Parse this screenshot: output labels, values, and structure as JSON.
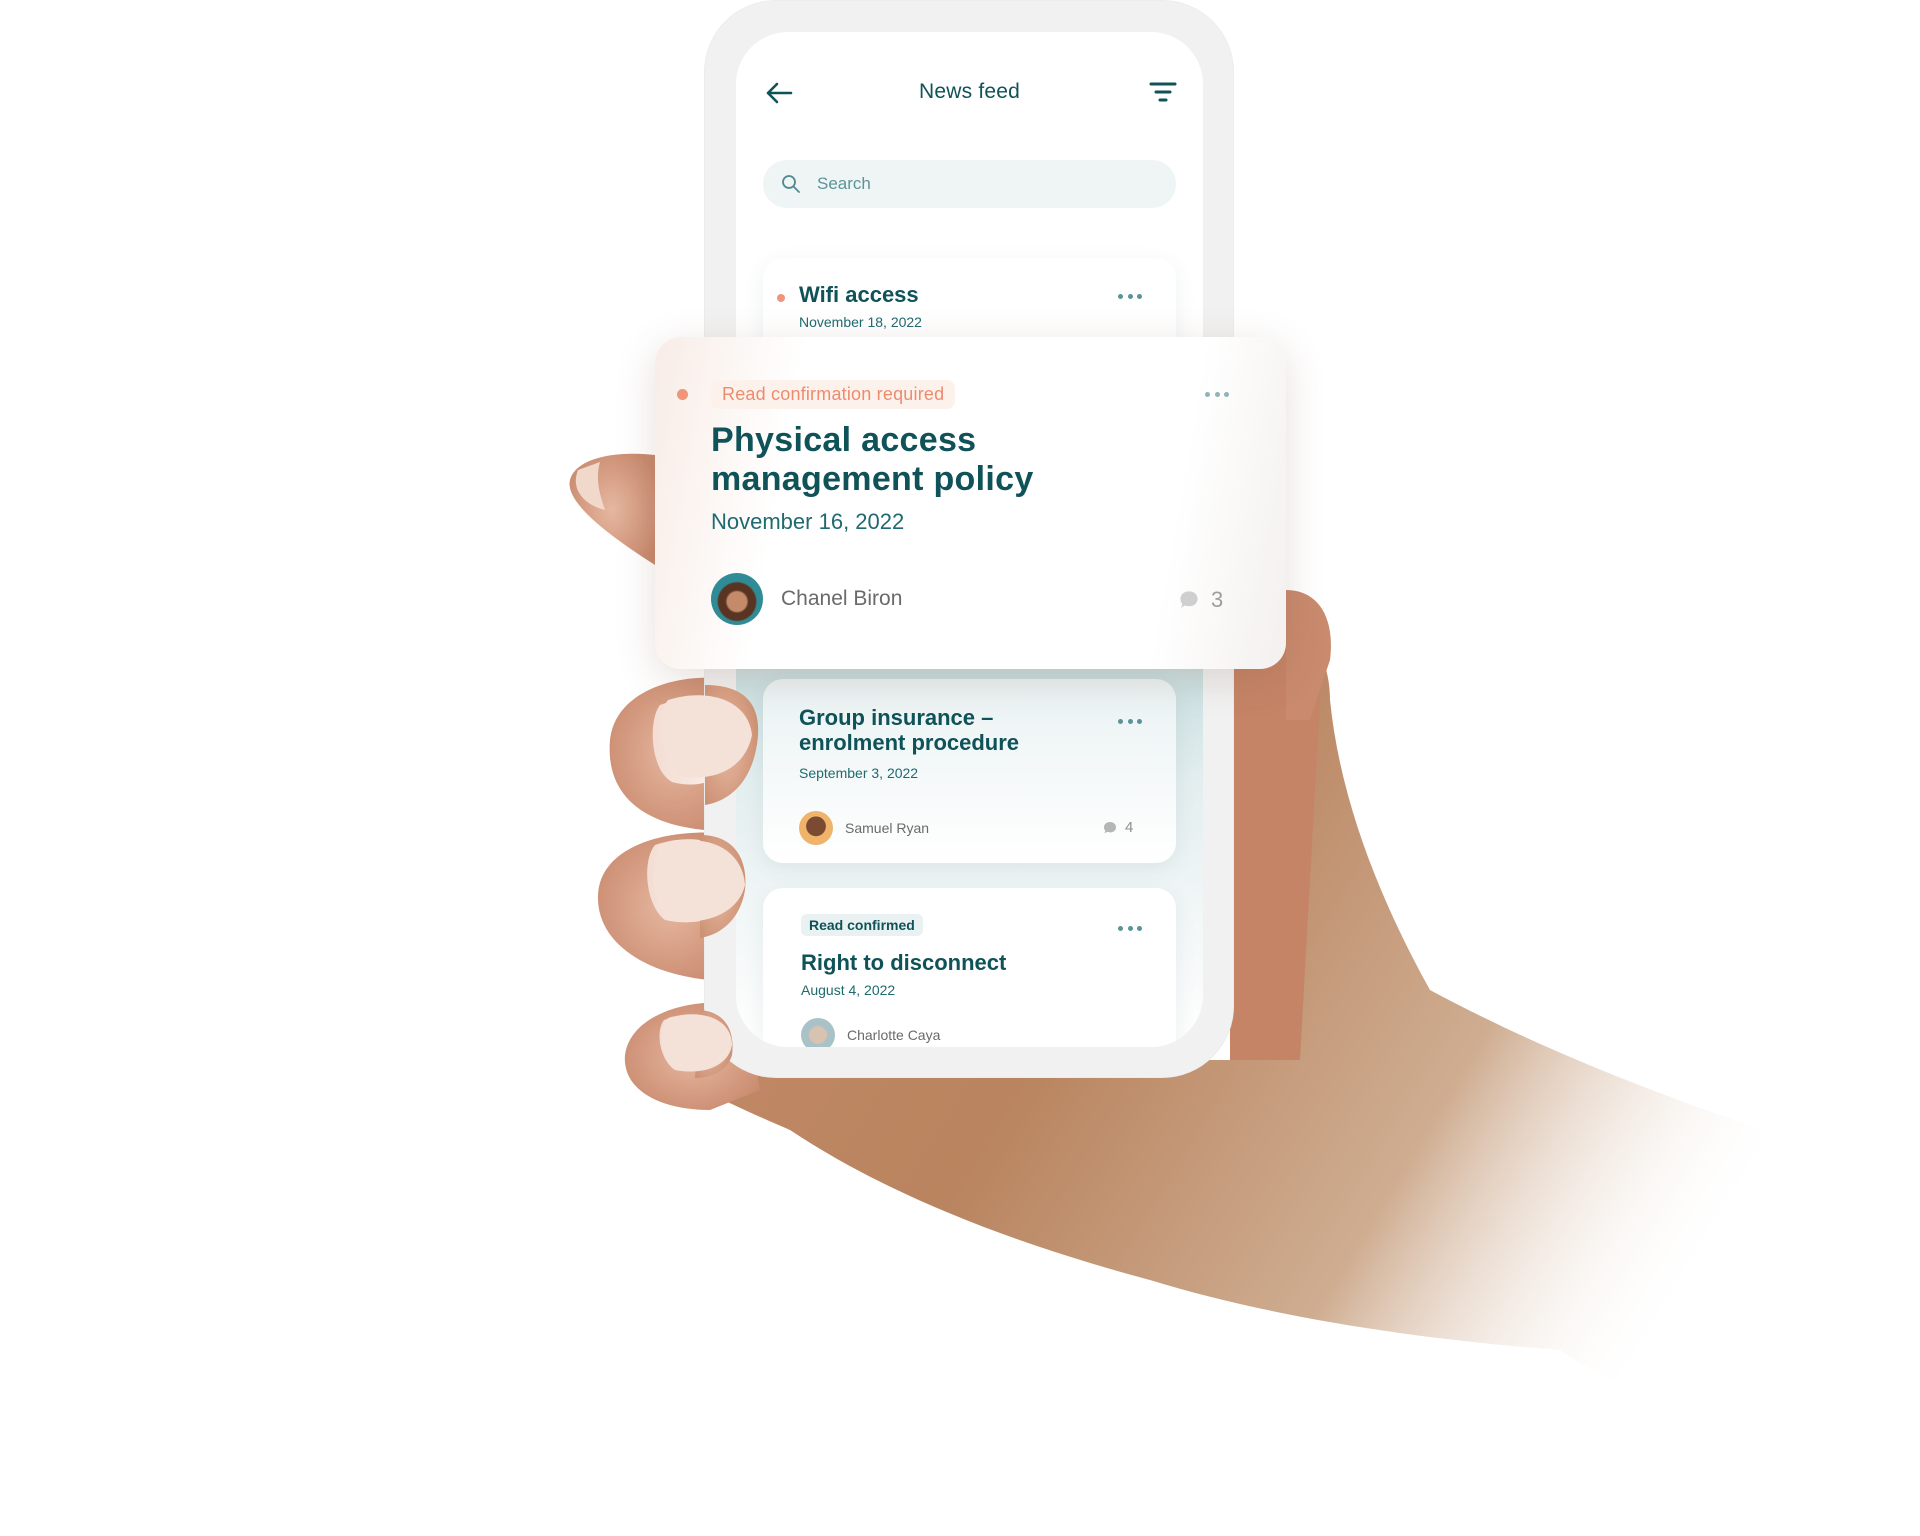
{
  "app": {
    "header": {
      "title": "News feed",
      "back_icon": "arrow-left-icon",
      "filter_icon": "filter-icon"
    },
    "search": {
      "placeholder": "Search",
      "value": "",
      "icon": "search-icon"
    },
    "colors": {
      "primary": "#0f5257",
      "accent": "#f0957a",
      "tag_required_bg": "#fdf1ec",
      "tag_confirmed_bg": "#e9f1f2",
      "search_bg": "#eff5f5"
    },
    "feed": [
      {
        "title": "Wifi access",
        "date": "November 18, 2022",
        "unread": true,
        "menu_icon": "more-horizontal-icon"
      },
      {
        "tag": "Read confirmation required",
        "title": "Physical access management policy",
        "date": "November 16, 2022",
        "author": "Chanel Biron",
        "comments": "3",
        "unread": true,
        "menu_icon": "more-horizontal-icon"
      },
      {
        "title": "Group insurance – enrolment procedure",
        "date": "September 3, 2022",
        "author": "Samuel Ryan",
        "comments": "4",
        "menu_icon": "more-horizontal-icon"
      },
      {
        "tag": "Read confirmed",
        "title": "Right to disconnect",
        "date": "August 4, 2022",
        "author": "Charlotte Caya",
        "menu_icon": "more-horizontal-icon"
      }
    ]
  }
}
